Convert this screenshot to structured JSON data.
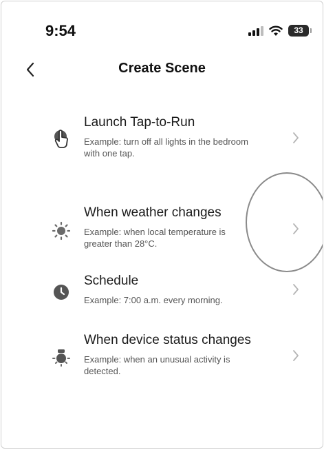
{
  "status_bar": {
    "time": "9:54",
    "battery": "33"
  },
  "header": {
    "title": "Create Scene"
  },
  "items": [
    {
      "title": "Launch Tap-to-Run",
      "subtitle": "Example: turn off all lights in the bedroom with one tap.",
      "icon": "tap-hand-icon"
    },
    {
      "title": "When weather changes",
      "subtitle": "Example: when local temperature is greater than 28°C.",
      "icon": "sun-icon"
    },
    {
      "title": "Schedule",
      "subtitle": "Example: 7:00 a.m. every morning.",
      "icon": "clock-icon"
    },
    {
      "title": "When device status changes",
      "subtitle": "Example: when an unusual activity is detected.",
      "icon": "device-icon"
    }
  ]
}
